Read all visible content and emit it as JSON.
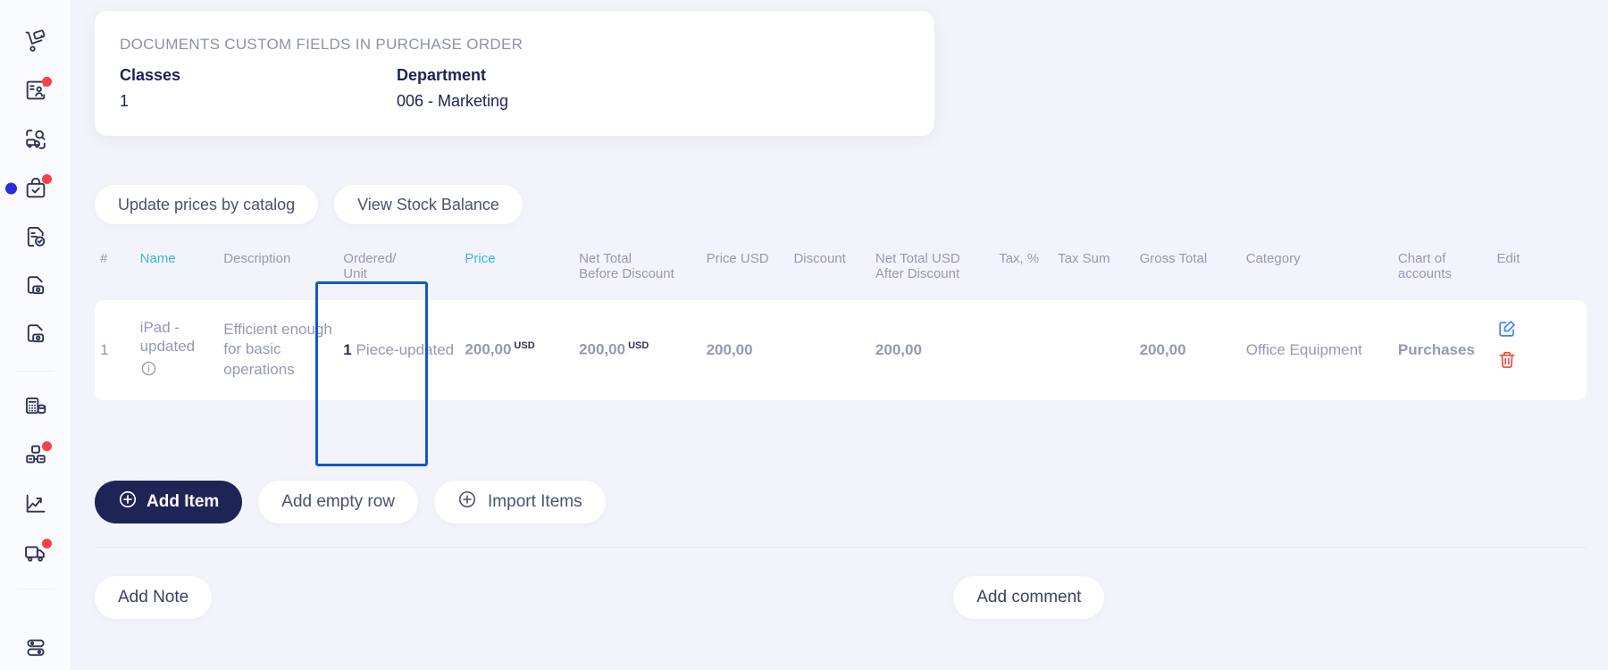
{
  "sidebar": {
    "items": [
      {
        "icon": "hand-truck-icon",
        "badge": false,
        "active": false
      },
      {
        "icon": "contact-card-icon",
        "badge": true,
        "active": false
      },
      {
        "icon": "truck-search-icon",
        "badge": false,
        "active": false
      },
      {
        "icon": "bag-check-icon",
        "badge": true,
        "active": true
      },
      {
        "icon": "document-check-icon",
        "badge": false,
        "active": false
      },
      {
        "icon": "document-payment-icon",
        "badge": false,
        "active": false
      },
      {
        "icon": "document-payment-alt-icon",
        "badge": false,
        "active": false
      },
      {
        "icon": "calculator-database-icon",
        "badge": false,
        "active": false
      },
      {
        "icon": "inventory-boxes-icon",
        "badge": true,
        "active": false
      },
      {
        "icon": "trending-chart-icon",
        "badge": false,
        "active": false
      },
      {
        "icon": "delivery-truck-icon",
        "badge": true,
        "active": false
      },
      {
        "icon": "settings-toggles-icon",
        "badge": false,
        "active": false
      }
    ]
  },
  "info_card": {
    "eyebrow": "DOCUMENTS CUSTOM FIELDS IN PURCHASE ORDER",
    "fields": [
      {
        "label": "Classes",
        "value": "1"
      },
      {
        "label": "Department",
        "value": "006 - Marketing"
      }
    ]
  },
  "actions": {
    "update_prices_label": "Update prices by catalog",
    "view_stock_label": "View Stock Balance"
  },
  "table": {
    "headers": [
      {
        "label": "#",
        "accent": false
      },
      {
        "label": "Name",
        "accent": true
      },
      {
        "label": "Description",
        "accent": false
      },
      {
        "label": "Ordered/\nUnit",
        "accent": false
      },
      {
        "label": "Price",
        "accent": true
      },
      {
        "label": "Net Total\nBefore Discount",
        "accent": false
      },
      {
        "label": "Price USD",
        "accent": false
      },
      {
        "label": "Discount",
        "accent": false
      },
      {
        "label": "Net Total USD\nAfter Discount",
        "accent": false
      },
      {
        "label": "Tax, %",
        "accent": false
      },
      {
        "label": "Tax Sum",
        "accent": false
      },
      {
        "label": "Gross Total",
        "accent": false
      },
      {
        "label": "Category",
        "accent": false
      },
      {
        "label": "Chart of\naccounts",
        "accent": false
      },
      {
        "label": "Edit",
        "accent": false
      }
    ],
    "rows": [
      {
        "index": "1",
        "name": "iPad - updated",
        "description": "Efficient enough for basic operations",
        "ordered_qty": "1",
        "ordered_unit": "Piece-updated",
        "price": "200,00",
        "price_currency": "USD",
        "net_total_before_discount": "200,00",
        "net_total_before_discount_currency": "USD",
        "price_usd": "200,00",
        "discount": "",
        "net_total_usd_after_discount": "200,00",
        "tax_percent": "",
        "tax_sum": "",
        "gross_total": "200,00",
        "category": "Office Equipment",
        "chart_of_accounts": "Purchases"
      }
    ]
  },
  "buttons": {
    "add_item": "Add Item",
    "add_empty_row": "Add empty row",
    "import_items": "Import Items",
    "add_note": "Add Note",
    "add_comment": "Add comment"
  },
  "colors": {
    "page_background": "#f3f4fb",
    "accent_teal": "#3ab6e3",
    "primary_navy": "#1f2456",
    "selection_blue": "#1457c8",
    "badge_red": "#f4424a",
    "delete_red": "#ef4444",
    "edit_blue": "#3b82f6",
    "muted_text": "#9599b4"
  }
}
